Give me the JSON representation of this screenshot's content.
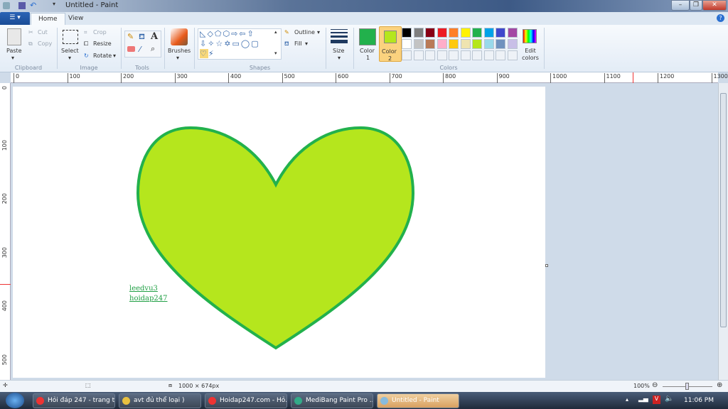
{
  "window": {
    "title": "Untitled - Paint",
    "minimize": "–",
    "restore": "❐",
    "close": "✕"
  },
  "tabs": [
    {
      "label": "Home",
      "active": true
    },
    {
      "label": "View",
      "active": false
    }
  ],
  "ribbon": {
    "clipboard": {
      "label": "Clipboard",
      "paste": "Paste",
      "cut": "Cut",
      "copy": "Copy"
    },
    "image": {
      "label": "Image",
      "select": "Select",
      "crop": "Crop",
      "resize": "Resize",
      "rotate": "Rotate"
    },
    "tools": {
      "label": "Tools"
    },
    "brushes": {
      "label": "Brushes"
    },
    "shapes": {
      "label": "Shapes",
      "outline": "Outline",
      "fill": "Fill",
      "selected": "heart"
    },
    "size": {
      "label": "Size"
    },
    "colors": {
      "label": "Colors",
      "color1_label": "Color",
      "color1_num": "1",
      "color2_label": "Color",
      "color2_num": "2",
      "edit": "Edit colors",
      "color1": "#22b14c",
      "color2": "#b5e61d",
      "palette_row1": [
        "#000000",
        "#7f7f7f",
        "#880015",
        "#ed1c24",
        "#ff7f27",
        "#fff200",
        "#22b14c",
        "#00a2e8",
        "#3f48cc",
        "#a349a4"
      ],
      "palette_row2": [
        "#ffffff",
        "#c3c3c3",
        "#b97a57",
        "#ffaec9",
        "#ffc90e",
        "#efe4b0",
        "#b5e61d",
        "#99d9ea",
        "#7092be",
        "#c8bfe7"
      ]
    }
  },
  "ruler": {
    "h": [
      "0",
      "100",
      "200",
      "300",
      "400",
      "500",
      "600",
      "700",
      "800",
      "900",
      "1000",
      "1100",
      "1200",
      "1300"
    ],
    "v": [
      "0",
      "100",
      "200",
      "300",
      "400",
      "500"
    ]
  },
  "canvas": {
    "heart_fill": "#b5e61d",
    "heart_outline": "#22b14c",
    "text_line1": "leedvu3",
    "text_line2": "hoidap247"
  },
  "status": {
    "size": "1000 × 674px",
    "zoom": "100%"
  },
  "taskbar": {
    "items": [
      {
        "label": "Hỏi đáp 247 - trang t...",
        "color": "#e33"
      },
      {
        "label": "avt đủ thể loại )",
        "color": "#e8c040"
      },
      {
        "label": "Hoidap247.com - Hỏ...",
        "color": "#e33"
      },
      {
        "label": "MediBang Paint Pro ...",
        "color": "#3a8"
      },
      {
        "label": "Untitled - Paint",
        "color": "#8bd"
      }
    ],
    "time": "11:06 PM"
  }
}
